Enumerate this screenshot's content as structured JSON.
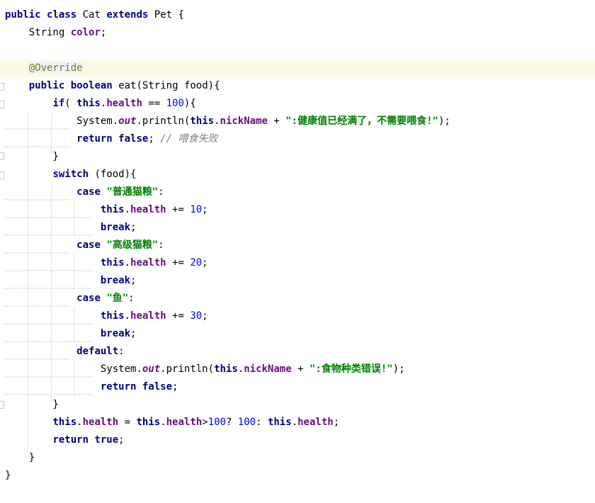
{
  "code": {
    "tokens": {
      "public": "public",
      "class": "class",
      "extends": "extends",
      "boolean": "boolean",
      "if": "if",
      "this": "this",
      "return": "return",
      "false": "false",
      "true": "true",
      "switch": "switch",
      "case": "case",
      "break": "break",
      "default": "default",
      "Cat": "Cat",
      "Pet": "Pet",
      "String": "String",
      "color": "color",
      "override": "@Override",
      "eat": "eat",
      "food": "food",
      "health": "health",
      "System": "System",
      "out": "out",
      "println": "println",
      "nickName": "nickName",
      "n100": "100",
      "n10": "10",
      "n20": "20",
      "n30": "30",
      "str_full": "\":健康值已经满了，不需要喂食!\"",
      "str_normal": "\"普通猫粮\"",
      "str_premium": "\"高级猫粮\"",
      "str_fish": "\"鱼\"",
      "str_error": "\":食物种类错误!\"",
      "comment_fail": "// 喂食失败"
    }
  },
  "colors": {
    "keyword": "#000080",
    "field": "#660e7a",
    "number": "#0000ff",
    "string": "#008000",
    "comment": "#808080",
    "annotation": "#808000",
    "current_line": "#fdfbe6"
  }
}
